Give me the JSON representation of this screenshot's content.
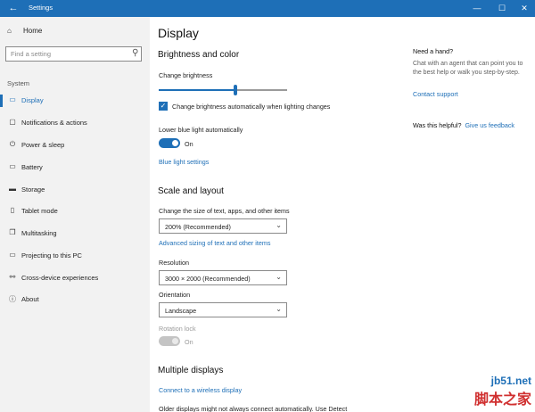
{
  "window": {
    "title": "Settings",
    "back_icon": "back-arrow-icon",
    "buttons": [
      "—",
      "☐",
      "✕"
    ]
  },
  "sidebar": {
    "home_label": "Home",
    "search_placeholder": "Find a setting",
    "group_label": "System",
    "items": [
      {
        "label": "Display",
        "icon": "display-icon"
      },
      {
        "label": "Notifications & actions",
        "icon": "notifications-icon"
      },
      {
        "label": "Power & sleep",
        "icon": "power-icon"
      },
      {
        "label": "Battery",
        "icon": "battery-icon"
      },
      {
        "label": "Storage",
        "icon": "storage-icon"
      },
      {
        "label": "Tablet mode",
        "icon": "tablet-icon"
      },
      {
        "label": "Multitasking",
        "icon": "multitasking-icon"
      },
      {
        "label": "Projecting to this PC",
        "icon": "projecting-icon"
      },
      {
        "label": "Cross-device experiences",
        "icon": "cross-device-icon"
      },
      {
        "label": "About",
        "icon": "info-icon"
      }
    ],
    "active_index": 0
  },
  "main": {
    "title": "Display",
    "brightness": {
      "heading": "Brightness and color",
      "label": "Change brightness",
      "level": 0.6,
      "auto_checkbox_label": "Change brightness automatically when lighting changes",
      "auto_checked": true,
      "blue_light_label": "Lower blue light automatically",
      "blue_light_state": "On",
      "blue_light_link": "Blue light settings"
    },
    "scale": {
      "heading": "Scale and layout",
      "size_label": "Change the size of text, apps, and other items",
      "size_value": "200% (Recommended)",
      "advanced_link": "Advanced sizing of text and other items",
      "resolution_label": "Resolution",
      "resolution_value": "3000 × 2000 (Recommended)",
      "orientation_label": "Orientation",
      "orientation_value": "Landscape",
      "rotation_lock_label": "Rotation lock",
      "rotation_lock_state": "On"
    },
    "multiple": {
      "heading": "Multiple displays",
      "wireless_link": "Connect to a wireless display",
      "note": "Older displays might not always connect automatically. Use Detect"
    }
  },
  "help": {
    "heading": "Need a hand?",
    "text": "Chat with an agent that can point you to the best help or walk you step-by-step.",
    "contact_link": "Contact support",
    "helpful_question": "Was this helpful?",
    "feedback_link": "Give us feedback"
  },
  "watermark": {
    "line1": "jb51.net",
    "line2": "脚本之家"
  }
}
